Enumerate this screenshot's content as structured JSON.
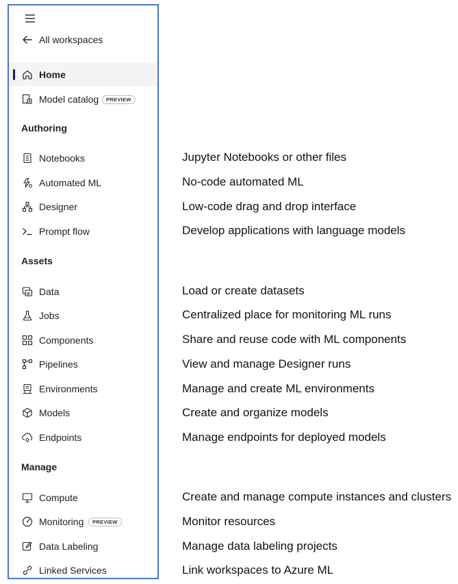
{
  "sidebar": {
    "menu_icon": "hamburger-icon",
    "back": {
      "label": "All workspaces",
      "icon": "arrow-left-icon"
    },
    "home": {
      "label": "Home",
      "icon": "home-icon"
    },
    "model_catalog": {
      "label": "Model catalog",
      "badge": "PREVIEW",
      "icon": "model-catalog-icon"
    },
    "sections": {
      "authoring": "Authoring",
      "assets": "Assets",
      "manage": "Manage"
    },
    "items": {
      "notebooks": {
        "label": "Notebooks",
        "icon": "notebook-icon"
      },
      "automated_ml": {
        "label": "Automated ML",
        "icon": "automated-ml-icon"
      },
      "designer": {
        "label": "Designer",
        "icon": "designer-icon"
      },
      "prompt_flow": {
        "label": "Prompt flow",
        "icon": "prompt-flow-icon"
      },
      "data": {
        "label": "Data",
        "icon": "data-icon"
      },
      "jobs": {
        "label": "Jobs",
        "icon": "flask-icon"
      },
      "components": {
        "label": "Components",
        "icon": "components-icon"
      },
      "pipelines": {
        "label": "Pipelines",
        "icon": "pipelines-icon"
      },
      "environments": {
        "label": "Environments",
        "icon": "environments-icon"
      },
      "models": {
        "label": "Models",
        "icon": "cube-icon"
      },
      "endpoints": {
        "label": "Endpoints",
        "icon": "endpoints-icon"
      },
      "compute": {
        "label": "Compute",
        "icon": "compute-icon"
      },
      "monitoring": {
        "label": "Monitoring",
        "badge": "PREVIEW",
        "icon": "gauge-icon"
      },
      "data_labeling": {
        "label": "Data Labeling",
        "icon": "edit-icon"
      },
      "linked_services": {
        "label": "Linked Services",
        "icon": "linked-services-icon"
      }
    }
  },
  "descriptions": {
    "notebooks": "Jupyter Notebooks or other files",
    "automated_ml": "No-code automated ML",
    "designer": "Low-code drag and drop interface",
    "prompt_flow": "Develop applications with language models",
    "data": "Load or create datasets",
    "jobs": "Centralized place for monitoring ML runs",
    "components": "Share and reuse code with ML components",
    "pipelines": "View and manage Designer runs",
    "environments": "Manage and create ML environments",
    "models": "Create and organize models",
    "endpoints": "Manage endpoints for deployed models",
    "compute": "Create and manage compute instances and clusters",
    "monitoring": "Monitor resources",
    "data_labeling": "Manage data labeling projects",
    "linked_services": "Link workspaces to Azure ML"
  },
  "colors": {
    "panel_border": "#4a78c2",
    "active_indicator": "#1a1a6e",
    "active_bg": "#f4f4f4"
  }
}
